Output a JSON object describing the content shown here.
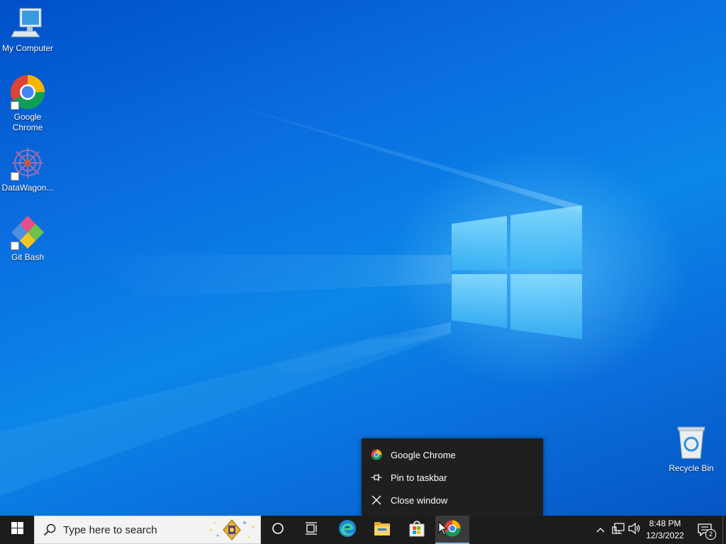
{
  "desktop": {
    "icons": [
      {
        "label": "My Computer",
        "icon": "computer-icon"
      },
      {
        "label": "Google Chrome",
        "icon": "chrome-icon"
      },
      {
        "label": "DataWagon...",
        "icon": "datawagon-icon"
      },
      {
        "label": "Git Bash",
        "icon": "git-bash-icon"
      },
      {
        "label": "Recycle Bin",
        "icon": "recycle-bin-icon"
      }
    ]
  },
  "jumplist": {
    "items": [
      {
        "label": "Google Chrome",
        "icon": "chrome-icon"
      },
      {
        "label": "Pin to taskbar",
        "icon": "pin-icon"
      },
      {
        "label": "Close window",
        "icon": "close-icon"
      }
    ]
  },
  "taskbar": {
    "search_placeholder": "Type here to search",
    "apps": [
      {
        "icon": "edge-icon"
      },
      {
        "icon": "file-explorer-icon"
      },
      {
        "icon": "store-icon"
      },
      {
        "icon": "chrome-icon",
        "active": true
      }
    ],
    "clock": {
      "time": "8:48 PM",
      "date": "12/3/2022"
    },
    "notifications_count": "2"
  },
  "colors": {
    "taskbar_bg": "#1c1c1c",
    "menu_bg": "#1f1f1f",
    "wallpaper_blue": "#0a78e0",
    "active_underline": "#76b9ed"
  }
}
